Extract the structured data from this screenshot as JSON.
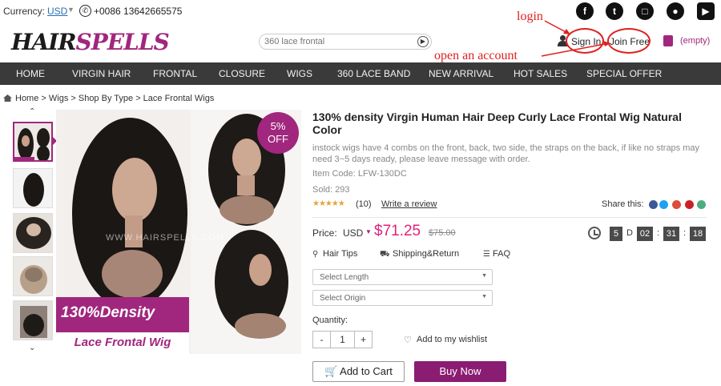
{
  "topbar": {
    "currency_label": "Currency:",
    "currency_value": "USD",
    "phone": "+0086 13642665575",
    "social": [
      "facebook-icon",
      "twitter-icon",
      "instagram-icon",
      "snapchat-icon",
      "youtube-icon"
    ]
  },
  "header": {
    "logo_hair": "HAIR",
    "logo_spells": "SPELLS",
    "search_placeholder": "360 lace frontal",
    "sign_in": "Sign In",
    "join_free": "Join Free",
    "cart": "(empty)",
    "accent": "#a0277d"
  },
  "annotations": {
    "login": "login",
    "open_account": "open an account"
  },
  "nav": [
    "HOME",
    "VIRGIN HAIR",
    "FRONTAL",
    "CLOSURE",
    "WIGS",
    "360 LACE BAND",
    "NEW ARRIVAL",
    "HOT SALES",
    "SPECIAL OFFER"
  ],
  "breadcrumb": "Home > Wigs > Shop By Type > Lace Frontal Wigs",
  "gallery": {
    "badge_pct": "5%",
    "badge_off": "OFF",
    "watermark": "WWW.HAIRSPELLS.COM",
    "density_title": "130%Density",
    "density_sub": "Lace Frontal Wig"
  },
  "product": {
    "title": "130% density Virgin Human Hair Deep Curly Lace Frontal Wig Natural Color",
    "description": "instock wigs have 4 combs on the front, back, two side, the straps on the back, if like no straps may need 3~5 days ready, please leave message with order.",
    "item_code": "Item Code: LFW-130DC",
    "sold": "Sold: 293",
    "rating_count": "(10)",
    "write_review": "Write a review",
    "share_label": "Share this:",
    "price_label": "Price:",
    "currency": "USD",
    "price": "$71.25",
    "old_price": "$75.00",
    "countdown": {
      "days": "5",
      "d": "D",
      "hours": "02",
      "minutes": "31",
      "seconds": "18"
    },
    "links": {
      "hair_tips": "Hair Tips",
      "shipping": "Shipping&Return",
      "faq": "FAQ"
    },
    "select_length": "Select Length",
    "select_origin": "Select Origin",
    "quantity_label": "Quantity:",
    "quantity": "1",
    "wishlist": "Add to my wishlist",
    "add_to_cart": "Add to Cart",
    "buy_now": "Buy Now"
  }
}
